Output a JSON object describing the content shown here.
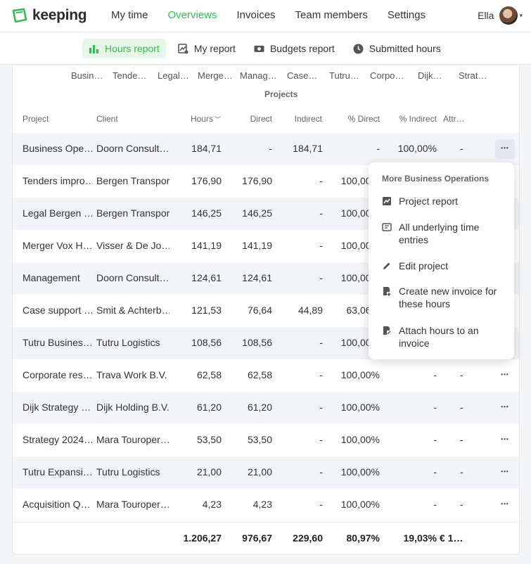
{
  "app": {
    "name": "keeping"
  },
  "nav": [
    {
      "label": "My time",
      "active": false
    },
    {
      "label": "Overviews",
      "active": true
    },
    {
      "label": "Invoices",
      "active": false
    },
    {
      "label": "Team members",
      "active": false
    },
    {
      "label": "Settings",
      "active": false
    }
  ],
  "user": {
    "name": "Ella"
  },
  "subnav": [
    {
      "label": "Hours report",
      "icon": "bar-chart-icon",
      "active": true
    },
    {
      "label": "My report",
      "icon": "report-icon",
      "active": false
    },
    {
      "label": "Budgets report",
      "icon": "money-icon",
      "active": false
    },
    {
      "label": "Submitted hours",
      "icon": "clock-icon",
      "active": false
    }
  ],
  "chart_axis": {
    "ticks": [
      "Busin…",
      "Tende…",
      "Legal…",
      "Merge…",
      "Manag…",
      "Case…",
      "Tutru…",
      "Corpo…",
      "Dijk…",
      "Strat…"
    ],
    "label": "Projects"
  },
  "table": {
    "columns": [
      "Project",
      "Client",
      "Hours",
      "Direct",
      "Indirect",
      "% Direct",
      "% Indirect",
      "Attr…"
    ],
    "rows": [
      [
        "Business Ope…",
        "Doorn Consult…",
        "184,71",
        "-",
        "184,71",
        "-",
        "100,00%",
        "-"
      ],
      [
        "Tenders impro…",
        "Bergen Transport",
        "176,90",
        "176,90",
        "-",
        "100,00%",
        "",
        ""
      ],
      [
        "Legal Bergen …",
        "Bergen Transport",
        "146,25",
        "146,25",
        "-",
        "100,00%",
        "",
        ""
      ],
      [
        "Merger Vox H…",
        "Visser & De Jo…",
        "141,19",
        "141,19",
        "-",
        "100,00%",
        "",
        ""
      ],
      [
        "Management",
        "Doorn Consult…",
        "124,61",
        "124,61",
        "-",
        "100,00%",
        "",
        ""
      ],
      [
        "Case support …",
        "Smit & Achterb…",
        "121,53",
        "76,64",
        "44,89",
        "63,06%",
        "",
        ""
      ],
      [
        "Tutru Busines…",
        "Tutru Logistics",
        "108,56",
        "108,56",
        "-",
        "100,00%",
        "",
        ""
      ],
      [
        "Corporate res…",
        "Trava Work B.V.",
        "62,58",
        "62,58",
        "-",
        "100,00%",
        "-",
        "-"
      ],
      [
        "Dijk Strategy …",
        "Dijk Holding B.V.",
        "61,20",
        "61,20",
        "-",
        "100,00%",
        "-",
        "-"
      ],
      [
        "Strategy 2024…",
        "Mara Touroper…",
        "53,50",
        "53,50",
        "-",
        "100,00%",
        "-",
        "-"
      ],
      [
        "Tutru Expansi…",
        "Tutru Logistics",
        "21,00",
        "21,00",
        "-",
        "100,00%",
        "-",
        "-"
      ],
      [
        "Acquisition Q…",
        "Mara Touroper…",
        "4,23",
        "4,23",
        "-",
        "100,00%",
        "-",
        "-"
      ]
    ],
    "totals": [
      "",
      "",
      "1.206,27",
      "976,67",
      "229,60",
      "80,97%",
      "19,03%",
      "€ 1…"
    ]
  },
  "menu": {
    "title": "More Business Operations",
    "items": [
      {
        "label": "Project report",
        "icon": "chart-icon"
      },
      {
        "label": "All underlying time entries",
        "icon": "time-entries-icon"
      },
      {
        "label": "Edit project",
        "icon": "pencil-icon"
      },
      {
        "label": "Create new invoice for these hours",
        "icon": "invoice-add-icon"
      },
      {
        "label": "Attach hours to an invoice",
        "icon": "invoice-attach-icon"
      }
    ]
  },
  "colors": {
    "accent": "#2fbf4f",
    "accent_bg": "#e6f7e9"
  }
}
